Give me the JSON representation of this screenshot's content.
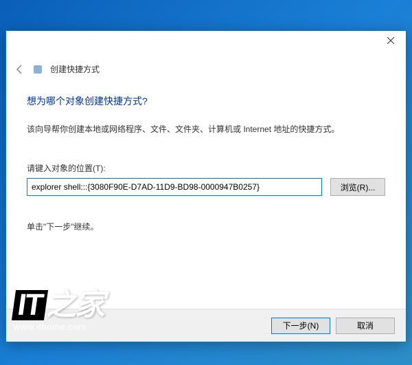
{
  "dialog": {
    "title": "创建快捷方式",
    "heading": "想为哪个对象创建快捷方式?",
    "description": "该向导帮你创建本地或网络程序、文件、文件夹、计算机或 Internet 地址的快捷方式。",
    "field_label": "请键入对象的位置(T):",
    "input_value": "explorer shell:::{3080F90E-D7AD-11D9-BD98-0000947B0257}",
    "browse_label": "浏览(R)...",
    "instruction": "单击\"下一步\"继续。",
    "next_label": "下一步(N)",
    "cancel_label": "取消"
  },
  "watermark": {
    "logo_prefix": "IT",
    "logo_suffix": "之家",
    "url": "www.ithome.com"
  }
}
